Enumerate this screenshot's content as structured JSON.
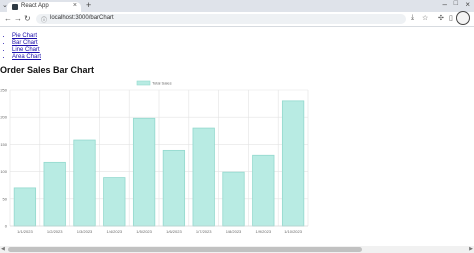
{
  "browser": {
    "tab_title": "React App",
    "tab_close_glyph": "×",
    "new_tab_glyph": "+",
    "url": "localhost:3000/barChart"
  },
  "nav": {
    "links": [
      "Pie Chart",
      "Bar Chart",
      "Line Chart",
      "Area Chart"
    ]
  },
  "page": {
    "title": "Order Sales Bar Chart"
  },
  "colors": {
    "bar_fill": "#b8ebe3",
    "bar_stroke": "#93d9ce",
    "grid": "#e3e3e3"
  },
  "chart_data": {
    "type": "bar",
    "title": "",
    "xlabel": "",
    "ylabel": "",
    "legend": {
      "label": "Total Sales",
      "position": "top"
    },
    "categories": [
      "1/1/2023",
      "1/2/2023",
      "1/3/2023",
      "1/4/2023",
      "1/5/2023",
      "1/6/2023",
      "1/7/2023",
      "1/8/2023",
      "1/9/2023",
      "1/10/2023"
    ],
    "series": [
      {
        "name": "Total Sales",
        "values": [
          70,
          117,
          158,
          89,
          198,
          139,
          180,
          99,
          130,
          230
        ]
      }
    ],
    "ylim": [
      0,
      250
    ],
    "yticks": [
      "0",
      "50",
      "100",
      "150",
      "200",
      "250"
    ],
    "grid": true
  }
}
